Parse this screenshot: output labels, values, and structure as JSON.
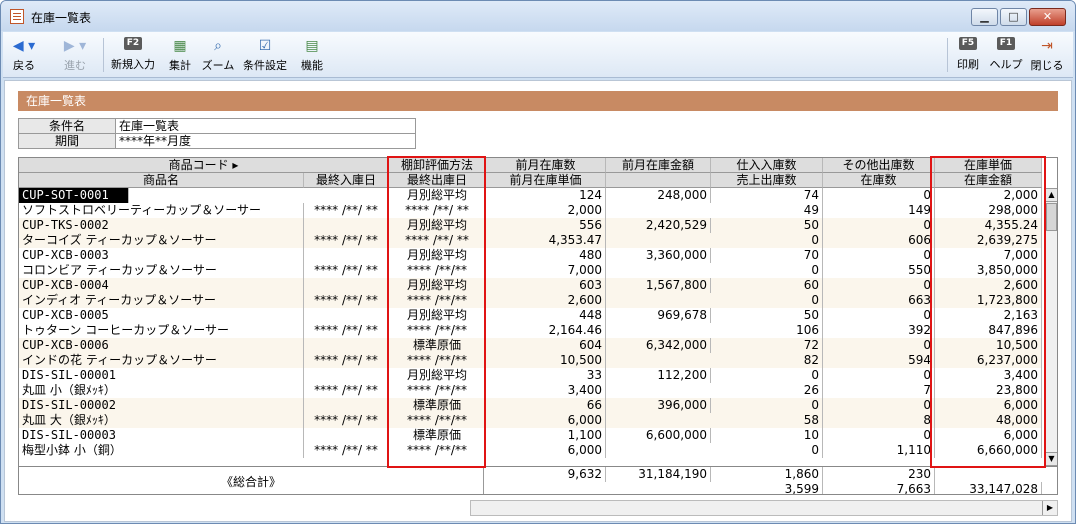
{
  "window": {
    "title": "在庫一覧表"
  },
  "toolbar": {
    "back": "戻る",
    "forward": "進む",
    "new_entry": "新規入力",
    "new_entry_key": "F2",
    "aggregate": "集計",
    "zoom": "ズーム",
    "condition": "条件設定",
    "function": "機能",
    "print": "印刷",
    "print_key": "F5",
    "help": "ヘルプ",
    "help_key": "F1",
    "close": "閉じる"
  },
  "section": {
    "title": "在庫一覧表"
  },
  "conditions": {
    "name_label": "条件名",
    "name_value": "在庫一覧表",
    "period_label": "期間",
    "period_value": "****年**月度"
  },
  "grid": {
    "headers1": [
      "商品コード ▸",
      "",
      "棚卸評価方法",
      "前月在庫数",
      "前月在庫金額",
      "仕入入庫数",
      "その他出庫数",
      "在庫単価"
    ],
    "headers2": [
      "商品名",
      "最終入庫日",
      "最終出庫日",
      "前月在庫単価",
      "",
      "売上出庫数",
      "在庫数",
      "在庫金額"
    ],
    "rows": [
      {
        "code": "CUP-SOT-0001",
        "name": "ソフトストロベリーティーカップ＆ソーサー",
        "last_in": "**** /**/ **",
        "method": "月別総平均",
        "last_out": "**** /**/ **",
        "prev_qty": "124",
        "prev_unit": "2,000",
        "prev_amt": "248,000",
        "in_qty": "74",
        "sales_qty": "49",
        "other_out": "0",
        "stock_qty": "149",
        "unit_price": "2,000",
        "stock_amt": "298,000"
      },
      {
        "code": "CUP-TKS-0002",
        "name": "ターコイズ ティーカップ＆ソーサー",
        "last_in": "**** /**/ **",
        "method": "月別総平均",
        "last_out": "**** /**/ **",
        "prev_qty": "556",
        "prev_unit": "4,353.47",
        "prev_amt": "2,420,529",
        "in_qty": "50",
        "sales_qty": "0",
        "other_out": "0",
        "stock_qty": "606",
        "unit_price": "4,355.24",
        "stock_amt": "2,639,275"
      },
      {
        "code": "CUP-XCB-0003",
        "name": "コロンビア ティーカップ＆ソーサー",
        "last_in": "**** /**/ **",
        "method": "月別総平均",
        "last_out": "**** /**/**",
        "prev_qty": "480",
        "prev_unit": "7,000",
        "prev_amt": "3,360,000",
        "in_qty": "70",
        "sales_qty": "0",
        "other_out": "0",
        "stock_qty": "550",
        "unit_price": "7,000",
        "stock_amt": "3,850,000"
      },
      {
        "code": "CUP-XCB-0004",
        "name": "インディオ ティーカップ＆ソーサー",
        "last_in": "**** /**/ **",
        "method": "月別総平均",
        "last_out": "**** /**/**",
        "prev_qty": "603",
        "prev_unit": "2,600",
        "prev_amt": "1,567,800",
        "in_qty": "60",
        "sales_qty": "0",
        "other_out": "0",
        "stock_qty": "663",
        "unit_price": "2,600",
        "stock_amt": "1,723,800"
      },
      {
        "code": "CUP-XCB-0005",
        "name": "トゥターン コーヒーカップ＆ソーサー",
        "last_in": "**** /**/ **",
        "method": "月別総平均",
        "last_out": "**** /**/**",
        "prev_qty": "448",
        "prev_unit": "2,164.46",
        "prev_amt": "969,678",
        "in_qty": "50",
        "sales_qty": "106",
        "other_out": "0",
        "stock_qty": "392",
        "unit_price": "2,163",
        "stock_amt": "847,896"
      },
      {
        "code": "CUP-XCB-0006",
        "name": "インドの花 ティーカップ＆ソーサー",
        "last_in": "**** /**/ **",
        "method": "標準原価",
        "last_out": "**** /**/**",
        "prev_qty": "604",
        "prev_unit": "10,500",
        "prev_amt": "6,342,000",
        "in_qty": "72",
        "sales_qty": "82",
        "other_out": "0",
        "stock_qty": "594",
        "unit_price": "10,500",
        "stock_amt": "6,237,000"
      },
      {
        "code": "DIS-SIL-00001",
        "name": "丸皿 小（銀ﾒｯｷ）",
        "last_in": "**** /**/ **",
        "method": "月別総平均",
        "last_out": "**** /**/**",
        "prev_qty": "33",
        "prev_unit": "3,400",
        "prev_amt": "112,200",
        "in_qty": "0",
        "sales_qty": "26",
        "other_out": "0",
        "stock_qty": "7",
        "unit_price": "3,400",
        "stock_amt": "23,800"
      },
      {
        "code": "DIS-SIL-00002",
        "name": "丸皿 大（銀ﾒｯｷ）",
        "last_in": "**** /**/ **",
        "method": "標準原価",
        "last_out": "**** /**/**",
        "prev_qty": "66",
        "prev_unit": "6,000",
        "prev_amt": "396,000",
        "in_qty": "0",
        "sales_qty": "58",
        "other_out": "0",
        "stock_qty": "8",
        "unit_price": "6,000",
        "stock_amt": "48,000"
      },
      {
        "code": "DIS-SIL-00003",
        "name": "梅型小鉢 小（銅）",
        "last_in": "**** /**/ **",
        "method": "標準原価",
        "last_out": "**** /**/**",
        "prev_qty": "1,100",
        "prev_unit": "6,000",
        "prev_amt": "6,600,000",
        "in_qty": "10",
        "sales_qty": "0",
        "other_out": "0",
        "stock_qty": "1,110",
        "unit_price": "6,000",
        "stock_amt": "6,660,000"
      }
    ],
    "totals": {
      "label": "《総合計》",
      "prev_qty": "9,632",
      "prev_amt": "31,184,190",
      "in_qty": "1,860",
      "other_out": "230",
      "sales_qty": "3,599",
      "stock_qty": "7,663",
      "stock_amt": "33,147,028"
    }
  },
  "colors": {
    "section_bar": "#c88a63",
    "highlight": "#e01414",
    "row_alt": "#fbf6ec"
  }
}
